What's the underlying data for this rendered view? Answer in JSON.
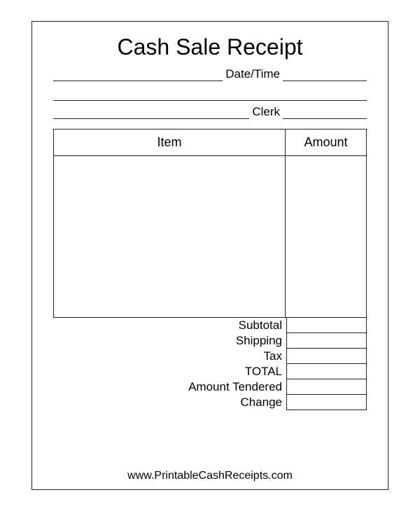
{
  "title": "Cash Sale Receipt",
  "meta": {
    "datetime_label": "Date/Time",
    "clerk_label": "Clerk"
  },
  "table": {
    "item_header": "Item",
    "amount_header": "Amount"
  },
  "totals": {
    "subtotal": "Subtotal",
    "shipping": "Shipping",
    "tax": "Tax",
    "total": "TOTAL",
    "tendered": "Amount Tendered",
    "change": "Change"
  },
  "footer": "www.PrintableCashReceipts.com"
}
